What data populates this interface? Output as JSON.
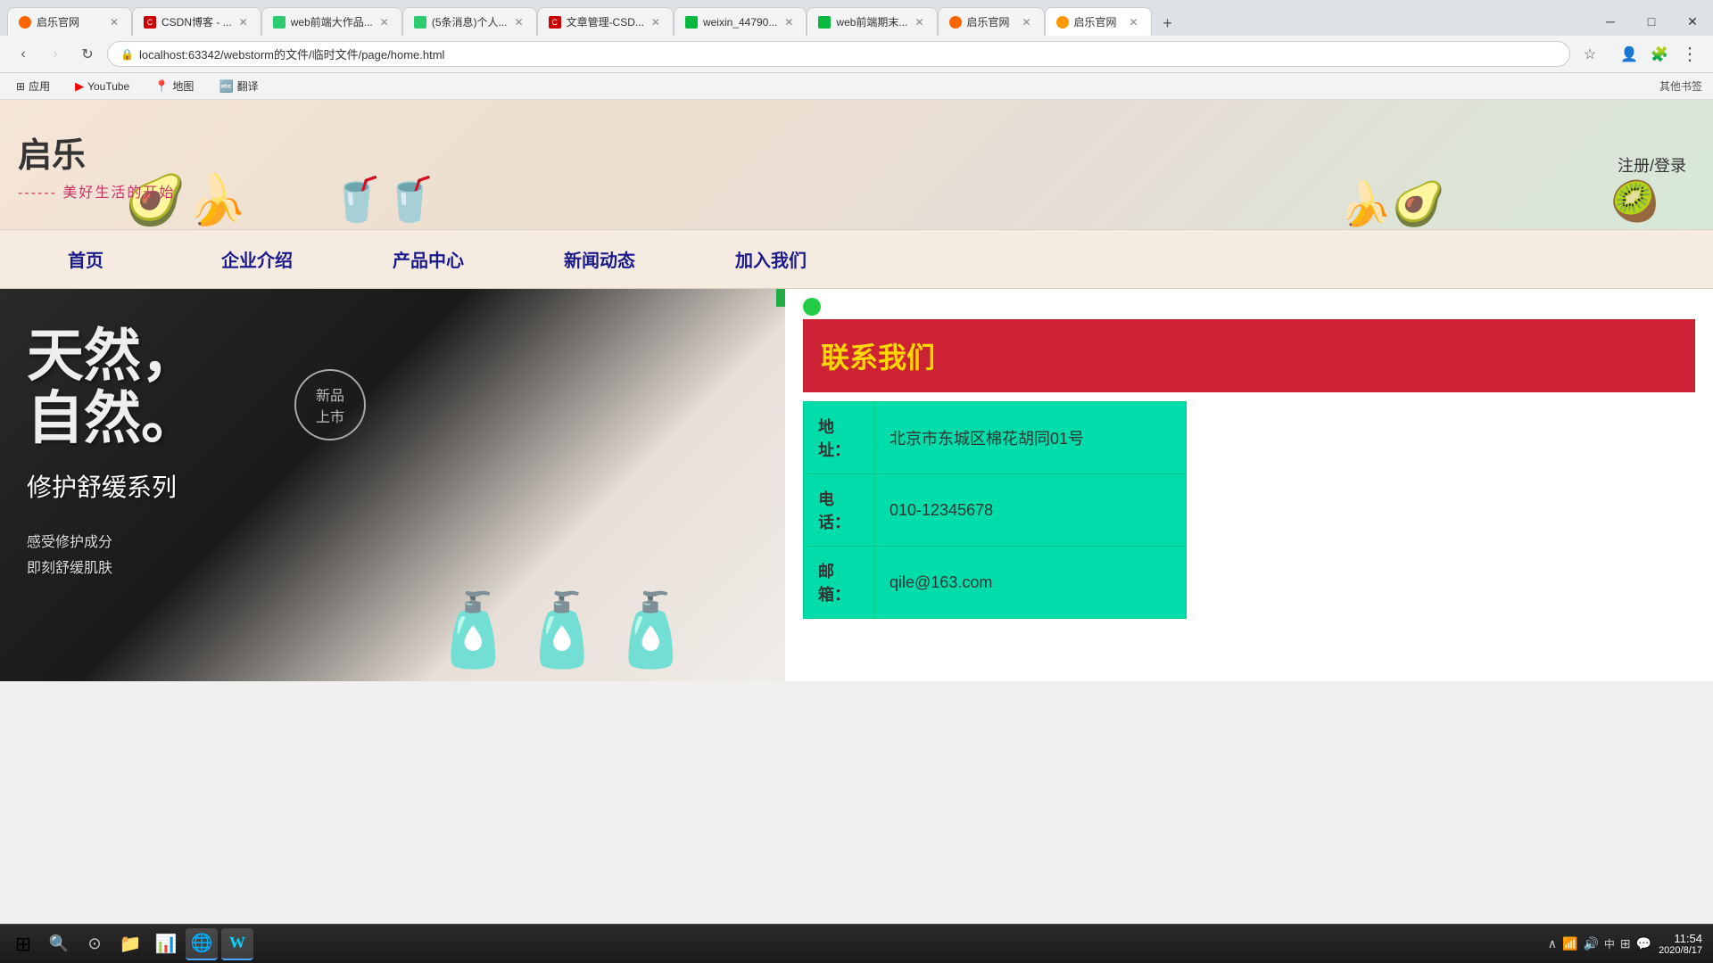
{
  "browser": {
    "tabs": [
      {
        "id": "tab1",
        "title": "启乐官网",
        "favicon_color": "#ff6600",
        "active": false
      },
      {
        "id": "tab2",
        "title": "CSDN博客 - ...",
        "favicon_color": "#cc0000",
        "active": false
      },
      {
        "id": "tab3",
        "title": "web前端大作品...",
        "favicon_color": "#2ecc71",
        "active": false
      },
      {
        "id": "tab4",
        "title": "(5条消息)个人...",
        "favicon_color": "#2ecc71",
        "active": false
      },
      {
        "id": "tab5",
        "title": "文章管理-CSD...",
        "favicon_color": "#cc0000",
        "active": false
      },
      {
        "id": "tab6",
        "title": "weixin_44790...",
        "favicon_color": "#2ecc71",
        "active": false
      },
      {
        "id": "tab7",
        "title": "web前端期末...",
        "favicon_color": "#2ecc71",
        "active": false
      },
      {
        "id": "tab8",
        "title": "启乐官网",
        "favicon_color": "#ff6600",
        "active": false
      },
      {
        "id": "tab9",
        "title": "启乐官网",
        "favicon_color": "#ff9900",
        "active": true
      }
    ],
    "address": "localhost:63342/webstorm的文件/临时文件/page/home.html",
    "bookmarks": [
      {
        "label": "应用",
        "favicon": "🔵"
      },
      {
        "label": "YouTube",
        "favicon": "▶"
      },
      {
        "label": "地图",
        "favicon": "📍"
      },
      {
        "label": "翻译",
        "favicon": "🔤"
      }
    ],
    "bookmarks_right": "其他书签"
  },
  "site": {
    "logo": "启乐",
    "tagline": "------美好生活的开始",
    "login_text": "注册/登录",
    "nav_items": [
      "首页",
      "企业介绍",
      "产品中心",
      "新闻动态",
      "加入我们"
    ],
    "hero": {
      "title_line1": "天然，",
      "title_line2": "自然。",
      "new_badge_line1": "新品",
      "new_badge_line2": "上市",
      "subtitle": "修护舒缓系列",
      "desc_line1": "感受修护成分",
      "desc_line2": "即刻舒缓肌肤"
    },
    "contact": {
      "header": "联系我们",
      "rows": [
        {
          "label": "地址：",
          "value": "北京市东城区棉花胡同01号"
        },
        {
          "label": "电话：",
          "value": "010-12345678"
        },
        {
          "label": "邮箱：",
          "value": "qile@163.com"
        }
      ]
    }
  },
  "taskbar": {
    "time": "11:54",
    "date": "2020/8/17",
    "icons": [
      "⊞",
      "🔍",
      "⊙",
      "📁",
      "📊",
      "🌐",
      "W"
    ],
    "tray_icons": [
      "∧",
      "🔊",
      "中",
      "⊞",
      "💬"
    ]
  }
}
